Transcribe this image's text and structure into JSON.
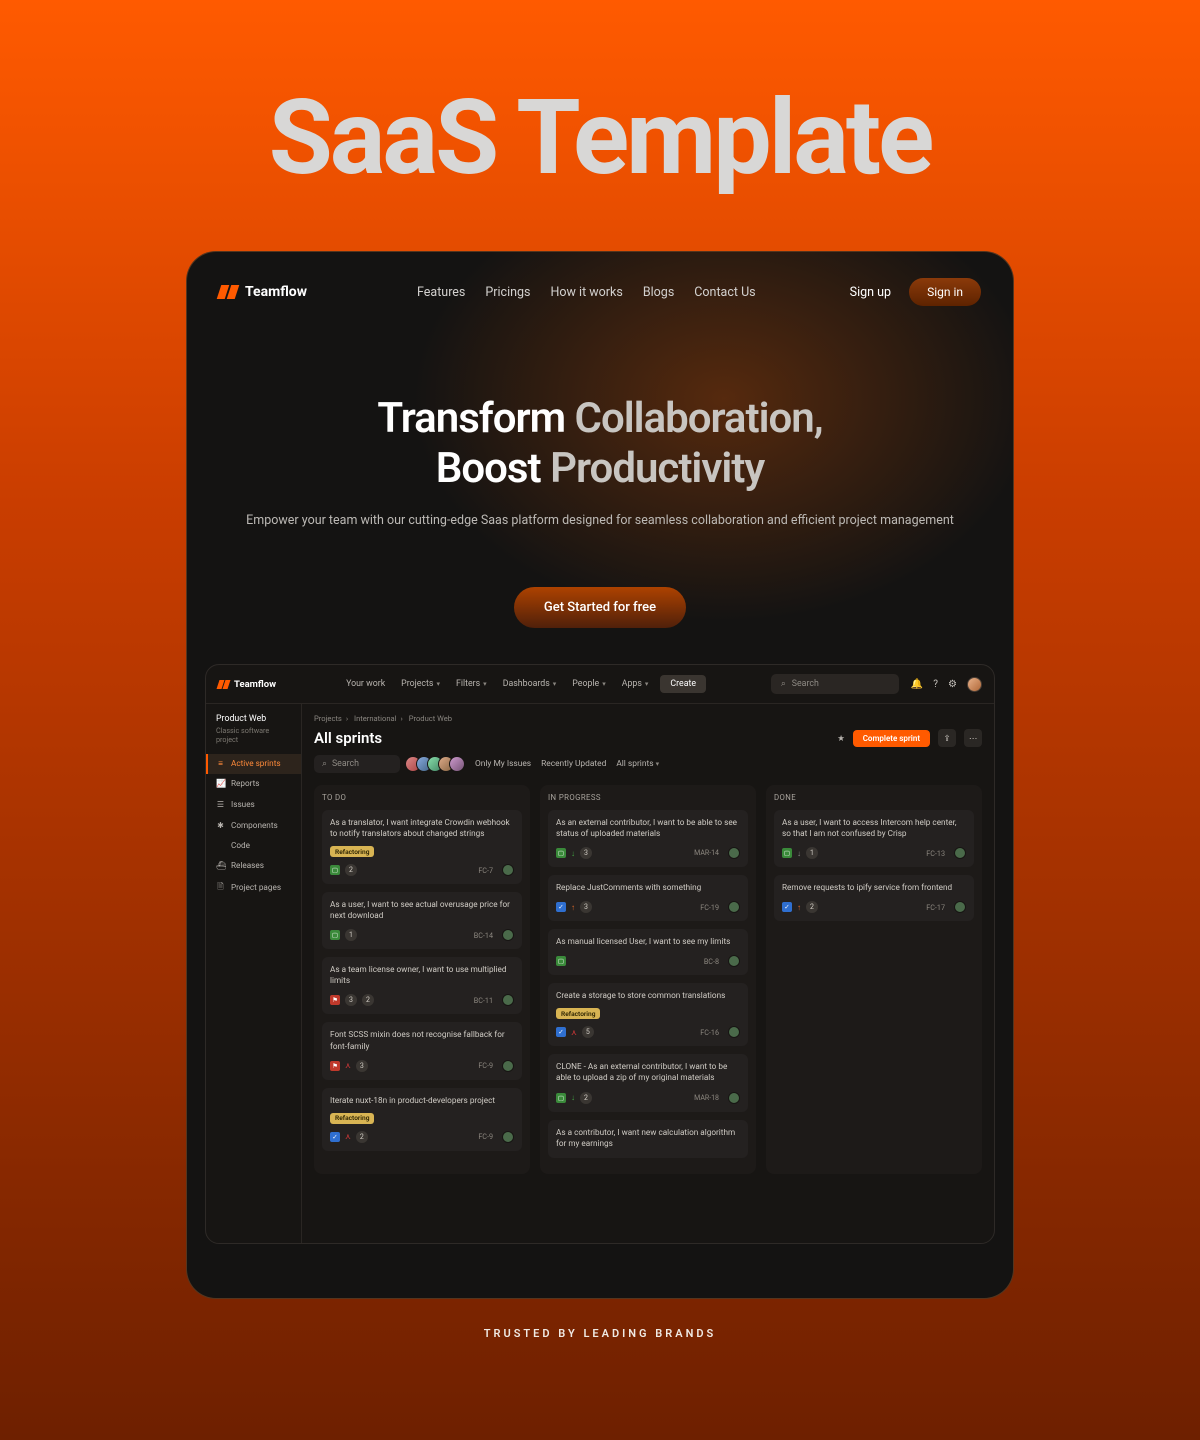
{
  "outer_title": "SaaS Template",
  "footer": "TRUSTED BY LEADING BRANDS",
  "site": {
    "brand": "Teamflow",
    "nav": [
      "Features",
      "Pricings",
      "How it works",
      "Blogs",
      "Contact Us"
    ],
    "signup": "Sign up",
    "signin": "Sign in",
    "hero_line1a": "Transform ",
    "hero_line1b": "Collaboration,",
    "hero_line2a": "Boost ",
    "hero_line2b": "Productivity",
    "hero_sub": "Empower your team with our cutting-edge Saas platform designed for seamless collaboration and efficient project management",
    "cta": "Get Started for free"
  },
  "app": {
    "brand": "Teamflow",
    "topnav": [
      {
        "label": "Your work",
        "dropdown": false
      },
      {
        "label": "Projects",
        "dropdown": true
      },
      {
        "label": "Filters",
        "dropdown": true
      },
      {
        "label": "Dashboards",
        "dropdown": true
      },
      {
        "label": "People",
        "dropdown": true
      },
      {
        "label": "Apps",
        "dropdown": true
      }
    ],
    "create": "Create",
    "search_placeholder": "Search",
    "sidebar": {
      "title": "Product Web",
      "subtitle": "Classic software project",
      "items": [
        {
          "icon": "≡",
          "label": "Active sprints",
          "active": true
        },
        {
          "icon": "📈",
          "label": "Reports"
        },
        {
          "icon": "☰",
          "label": "Issues"
        },
        {
          "icon": "✱",
          "label": "Components"
        },
        {
          "icon": "</>",
          "label": "Code"
        },
        {
          "icon": "⛴",
          "label": "Releases"
        },
        {
          "icon": "🗎",
          "label": "Project pages"
        }
      ]
    },
    "breadcrumb": [
      "Projects",
      "International",
      "Product Web"
    ],
    "page_title": "All sprints",
    "mini_search_placeholder": "Search",
    "filters": [
      "Only My Issues",
      "Recently Updated",
      "All sprints"
    ],
    "complete": "Complete sprint",
    "columns": [
      {
        "title": "TO DO",
        "cards": [
          {
            "title": "As a translator, I want integrate Crowdin webhook to notify translators about changed strings",
            "label": "Refactoring",
            "type": "story",
            "count": "2",
            "id": "FC-7"
          },
          {
            "title": "As a user, I want to see actual overusage price for next download",
            "type": "story",
            "count": "1",
            "id": "BC-14"
          },
          {
            "title": "As a team license owner, I want to use multiplied limits",
            "type": "flag",
            "count": "3",
            "count2": "2",
            "id": "BC-11"
          },
          {
            "title": "Font SCSS mixin does not recognise fallback for font-family",
            "type": "flag",
            "prio": "dbl",
            "count": "3",
            "id": "FC-9"
          },
          {
            "title": "Iterate nuxt-18n in product-developers project",
            "label": "Refactoring",
            "type": "task",
            "prio": "dbl",
            "count": "2",
            "id": "FC-9"
          }
        ]
      },
      {
        "title": "IN PROGRESS",
        "cards": [
          {
            "title": "As an external contributor, I want to be able to see status of uploaded materials",
            "type": "story",
            "prio": "down",
            "count": "3",
            "date": "MAR-14"
          },
          {
            "title": "Replace JustComments with something",
            "type": "task",
            "prio": "up",
            "count": "3",
            "id": "FC-19"
          },
          {
            "title": "As manual licensed User, I want to see my limits",
            "type": "story",
            "id": "BC-8"
          },
          {
            "title": "Create a storage to store common translations",
            "label": "Refactoring",
            "type": "task",
            "prio": "dbl",
            "count": "5",
            "id": "FC-16"
          },
          {
            "title": "CLONE - As an external contributor, I want to be able to upload a zip of my original materials",
            "type": "story",
            "prio": "down",
            "count": "2",
            "date": "MAR-18"
          },
          {
            "title": "As a contributor, I want new calculation algorithm for my earnings"
          }
        ]
      },
      {
        "title": "DONE",
        "cards": [
          {
            "title": "As a user, I want to access Intercom help center, so that I am not confused by Crisp",
            "type": "story",
            "prio": "down-grey",
            "count": "1",
            "id": "FC-13"
          },
          {
            "title": "Remove requests to ipify service from frontend",
            "type": "task",
            "prio": "up",
            "count": "2",
            "id": "FC-17"
          }
        ]
      }
    ]
  }
}
